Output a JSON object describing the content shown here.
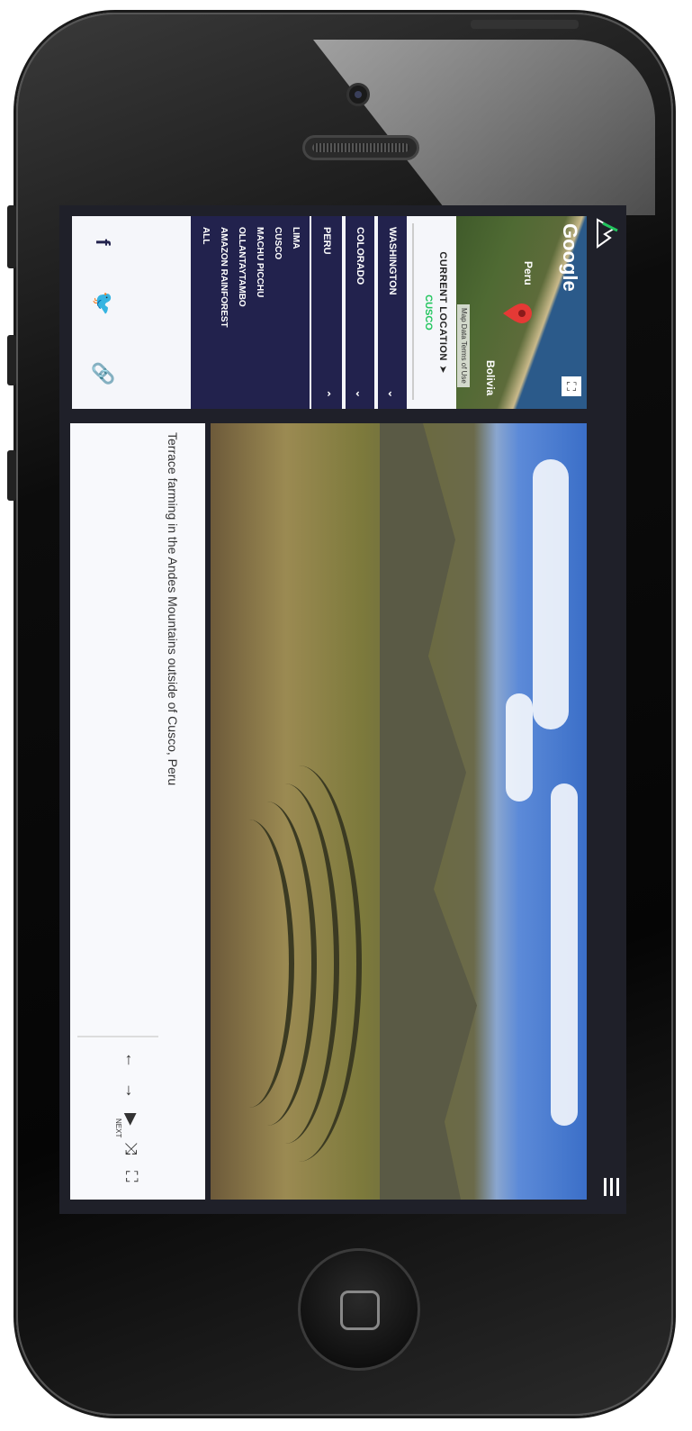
{
  "map": {
    "brand": "Google",
    "labels": [
      "Peru",
      "Bolivia"
    ],
    "terms": "Map Data  Terms of Use",
    "expand_icon": "expand-icon"
  },
  "current_location": {
    "label": "CURRENT LOCATION",
    "value": "CUSCO",
    "accent": "#22c55e"
  },
  "locations": {
    "items": [
      "WASHINGTON",
      "COLORADO",
      "PERU"
    ],
    "peru_subitems": [
      "LIMA",
      "CUSCO",
      "MACHU PICCHU",
      "OLLANTAYTAMBO",
      "AMAZON RAINFOREST",
      "ALL"
    ]
  },
  "social": [
    "facebook-icon",
    "twitter-icon",
    "link-icon"
  ],
  "photo": {
    "caption": "Terrace farming in the Andes Mountains outside of Cusco, Peru"
  },
  "nav": {
    "next_label": "NEXT"
  },
  "colors": {
    "panel_bg": "#f5f6fa",
    "nav_bg": "#22224d",
    "screen_bg": "#1f2029"
  }
}
